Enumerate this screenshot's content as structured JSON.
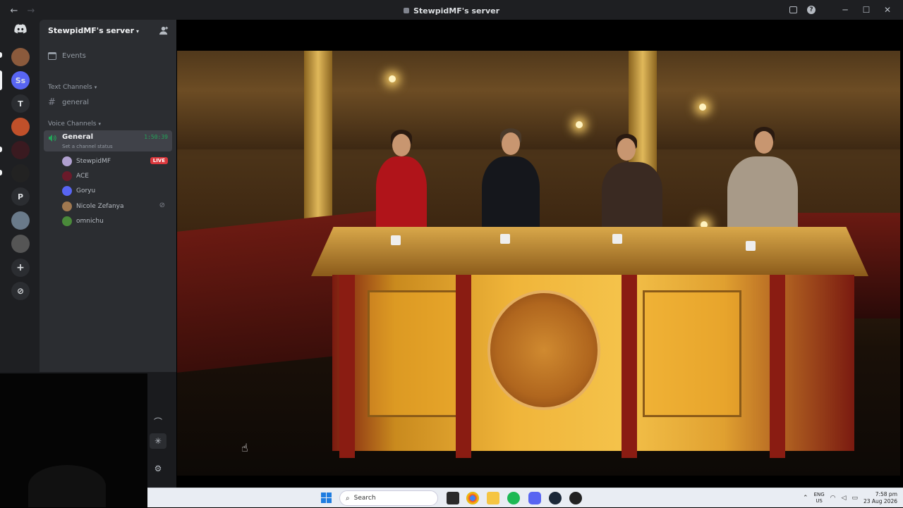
{
  "window": {
    "title": "StewpidMF's server",
    "nav_back": "←",
    "nav_forward": "→",
    "minimize": "─",
    "maximize": "☐",
    "close": "✕"
  },
  "rail": {
    "servers": [
      {
        "label": "",
        "color": "#5865f2"
      },
      {
        "label": "",
        "color": "#8b5a3c"
      },
      {
        "label": "Ss",
        "color": "#5865f2"
      },
      {
        "label": "T",
        "color": "#2b2d31"
      },
      {
        "label": "",
        "color": "#c0502a"
      },
      {
        "label": "",
        "color": "#3a1a20"
      },
      {
        "label": "",
        "color": "#222"
      },
      {
        "label": "P",
        "color": "#2b2d31"
      },
      {
        "label": "",
        "color": "#6a7a8a"
      },
      {
        "label": "",
        "color": "#555"
      }
    ],
    "add_server": "+",
    "explore": "⊘"
  },
  "sidebar": {
    "server_name": "StewpidMF's server",
    "events_label": "Events",
    "text_category": "Text Channels",
    "text_channels": [
      "general"
    ],
    "voice_category": "Voice Channels",
    "voice_channel": {
      "name": "General",
      "timer": "1:50:39",
      "status_placeholder": "Set a channel status"
    },
    "members": [
      {
        "name": "StewpidMF",
        "badge": "LIVE",
        "avatar_color": "#b0a0d0"
      },
      {
        "name": "ACE",
        "badge": "",
        "avatar_color": "#6a1a2a"
      },
      {
        "name": "Goryu",
        "badge": "",
        "avatar_color": "#5865f2"
      },
      {
        "name": "Nicole Zefanya",
        "badge": "",
        "avatar_color": "#a07850"
      },
      {
        "name": "omnichu",
        "badge": "",
        "avatar_color": "#4a8a3a"
      }
    ]
  },
  "taskbar": {
    "search_placeholder": "Search",
    "lang_top": "ENG",
    "lang_bottom": "US",
    "time": "7:58 pm",
    "date": "23 Aug 2026"
  }
}
